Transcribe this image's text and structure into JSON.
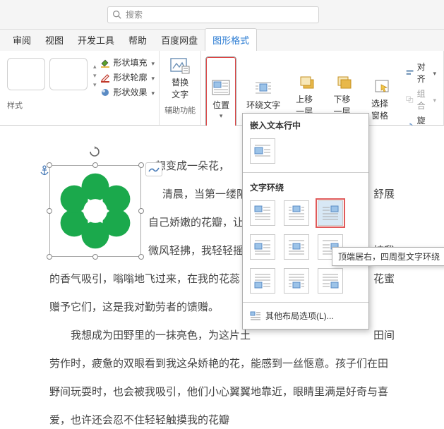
{
  "search": {
    "placeholder": "搜索"
  },
  "tabs": {
    "review": "审阅",
    "view": "视图",
    "devtools": "开发工具",
    "help": "帮助",
    "baidudisk": "百度网盘",
    "shapeformat": "图形格式"
  },
  "ribbon": {
    "styles_label": "样式",
    "fill": "形状填充",
    "outline": "形状轮廓",
    "effect": "形状效果",
    "alttext": "替换\n文字",
    "alttext_group": "辅助功能",
    "position": "位置",
    "wrap": "环绕文字",
    "bringforward": "上移一层",
    "sendback": "下移一层",
    "selection": "选择窗格",
    "align": "对齐",
    "group": "组合",
    "rotate": "旋转"
  },
  "dropdown": {
    "inline_title": "嵌入文本行中",
    "wrap_title": "文字环绕",
    "more": "其他布局选项(L)..."
  },
  "tooltip": "顶端居右，四周型文字环绕",
  "doc": {
    "p1a": "想变成一朵花，",
    "p1b": "清晨，当第一缕阳",
    "p1c": "自己娇嫩的花瓣，让晨",
    "p1_right": "舒展",
    "p1d": "微风轻拂，我轻轻摇曳",
    "p1d_right": "披我",
    "p2": "的香气吸引，嗡嗡地飞过来，在我的花蕊",
    "p2_right": "花蜜",
    "p3": "赠予它们，这是我对勤劳者的馈赠。",
    "p4a": "我想成为田野里的一抹亮色，为这片土",
    "p4a_right": "田间",
    "p4b": "劳作时，疲惫的双眼看到我这朵娇艳的花，能感到一丝惬意。孩子们在田",
    "p4c": "野间玩耍时，也会被我吸引，他们小心翼翼地靠近，眼睛里满是好奇与喜",
    "p4d": "爱，也许还会忍不住轻轻触摸我的花瓣"
  }
}
